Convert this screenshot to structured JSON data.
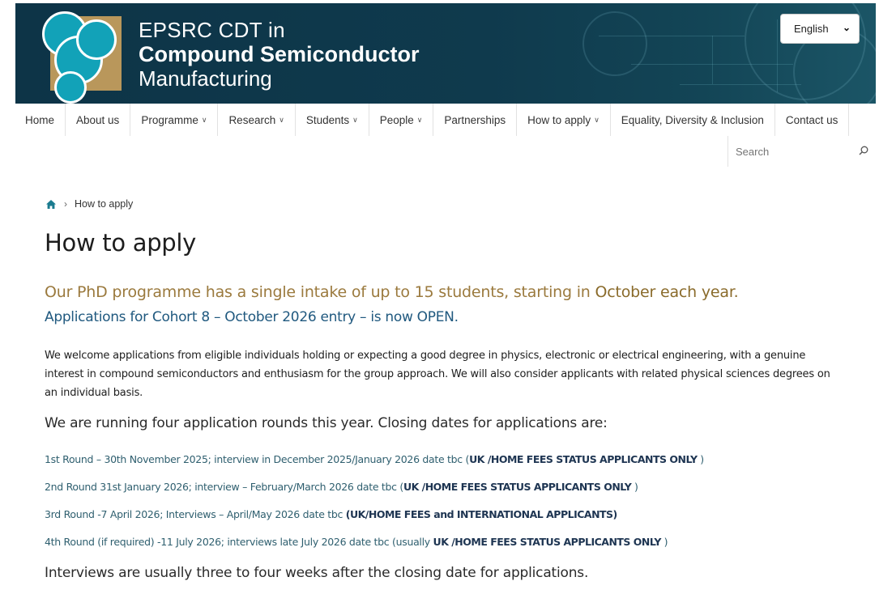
{
  "header": {
    "title_line1": "EPSRC CDT in",
    "title_line2": "Compound Semiconductor",
    "title_line3": "Manufacturing",
    "language": "English",
    "brand_dark": "#0d3447",
    "logo_gold": "#b9975b",
    "logo_teal": "#12a2b8"
  },
  "nav": {
    "items": [
      {
        "label": "Home",
        "dropdown": false
      },
      {
        "label": "About us",
        "dropdown": false
      },
      {
        "label": "Programme",
        "dropdown": true
      },
      {
        "label": "Research",
        "dropdown": true
      },
      {
        "label": "Students",
        "dropdown": true
      },
      {
        "label": "People",
        "dropdown": true
      },
      {
        "label": "Partnerships",
        "dropdown": false
      },
      {
        "label": "How to apply",
        "dropdown": true
      },
      {
        "label": "Equality, Diversity & Inclusion",
        "dropdown": false
      },
      {
        "label": "Contact us",
        "dropdown": false
      }
    ],
    "search_placeholder": "Search",
    "search_icon": "search-icon",
    "caret_icon": "chevron-down-icon"
  },
  "breadcrumb": {
    "home_icon": "home-icon",
    "current": "How to apply"
  },
  "main": {
    "title": "How to apply",
    "lead_part1": "Our PhD programme has a single intake of up to 15 students, starting in ",
    "lead_highlight": "October each year.",
    "open_notice": "Applications for Cohort 8 – October 2026 entry – is now OPEN.",
    "intro": "We welcome applications from eligible individuals holding or expecting a good degree in physics, electronic or electrical engineering, with a genuine interest in compound semiconductors and enthusiasm for the group approach. We will also consider applicants with related physical sciences degrees on an individual basis.",
    "rounds_heading": "We are running four application rounds this year. Closing dates for applications are:",
    "rounds": [
      {
        "text": "1st Round – 30th November 2025; interview in December 2025/January 2026 date tbc (",
        "strong": "UK /HOME FEES STATUS APPLICANTS ONLY",
        "tail": " )"
      },
      {
        "text": "2nd Round 31st January 2026; interview – February/March 2026 date tbc (",
        "strong": "UK /HOME FEES STATUS APPLICANTS ONLY",
        "tail": " )"
      },
      {
        "text": "3rd Round -7 April 2026; Interviews – April/May 2026 date tbc ",
        "strong": "(UK/HOME FEES and INTERNATIONAL APPLICANTS)",
        "tail": ""
      },
      {
        "text": "4th Round (if required) -11 July 2026; interviews late July 2026 date tbc (usually ",
        "strong": "UK /HOME FEES STATUS APPLICANTS ONLY",
        "tail": " )"
      }
    ],
    "interview_note": "Interviews are usually three to four weeks after the closing date for applications."
  }
}
